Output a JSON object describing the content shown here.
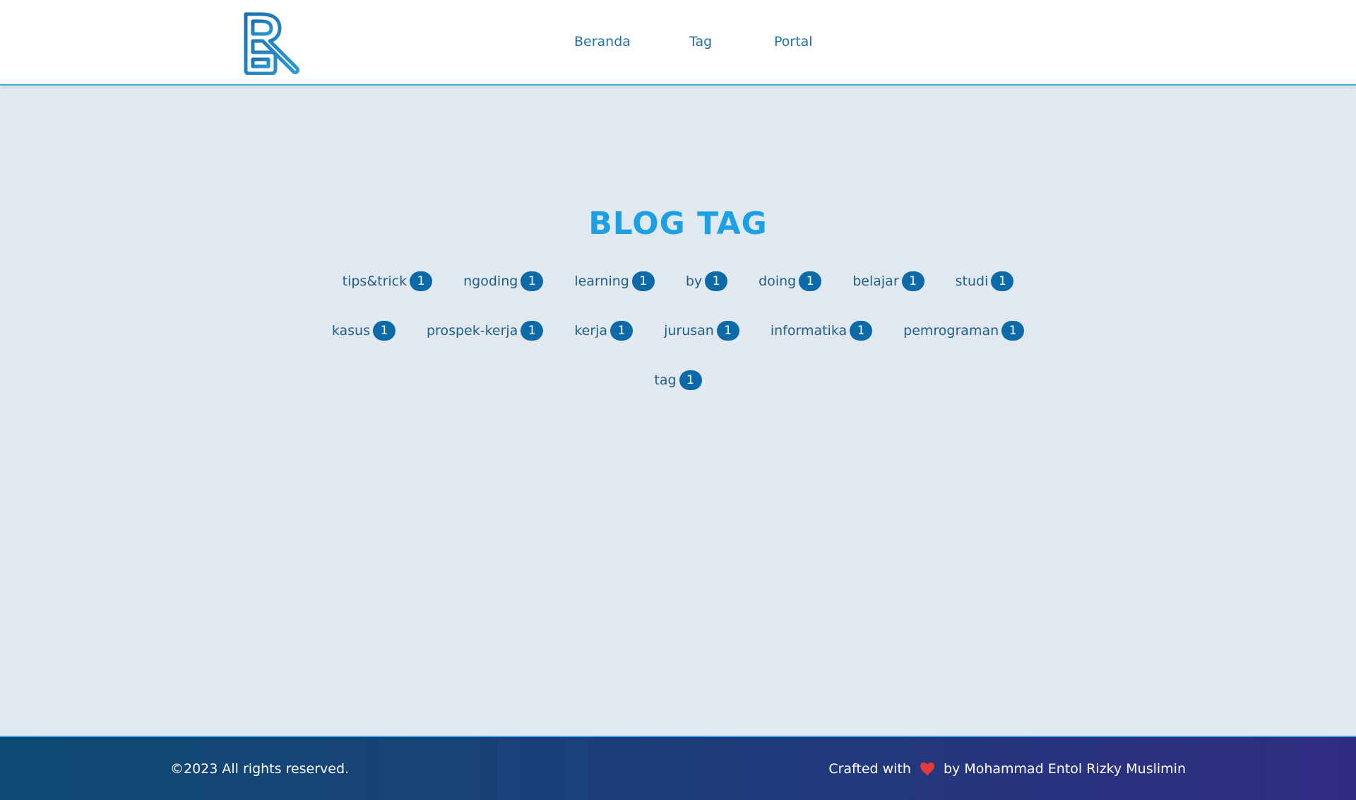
{
  "header": {
    "nav": [
      {
        "label": "Beranda"
      },
      {
        "label": "Tag"
      },
      {
        "label": "Portal"
      }
    ],
    "logo_icon": "br-logo-icon",
    "accent_color": "#38aee6"
  },
  "main": {
    "title": "BLOG TAG",
    "tag_rows": [
      [
        {
          "name": "tips&trick",
          "count": "1"
        },
        {
          "name": "ngoding",
          "count": "1"
        },
        {
          "name": "learning",
          "count": "1"
        },
        {
          "name": "by",
          "count": "1"
        },
        {
          "name": "doing",
          "count": "1"
        },
        {
          "name": "belajar",
          "count": "1"
        },
        {
          "name": "studi",
          "count": "1"
        }
      ],
      [
        {
          "name": "kasus",
          "count": "1"
        },
        {
          "name": "prospek-kerja",
          "count": "1"
        },
        {
          "name": "kerja",
          "count": "1"
        },
        {
          "name": "jurusan",
          "count": "1"
        },
        {
          "name": "informatika",
          "count": "1"
        },
        {
          "name": "pemrograman",
          "count": "1"
        }
      ],
      [
        {
          "name": "tag",
          "count": "1"
        }
      ]
    ],
    "badge_color": "#0d6aa8",
    "title_color": "#1aa0e3"
  },
  "footer": {
    "copyright": "©2023 All rights reserved.",
    "crafted_prefix": "Crafted with",
    "crafted_suffix": "by Mohammad Entol Rizky Muslimin",
    "heart_icon": "heart-icon",
    "heart_color": "#e53b3b"
  }
}
